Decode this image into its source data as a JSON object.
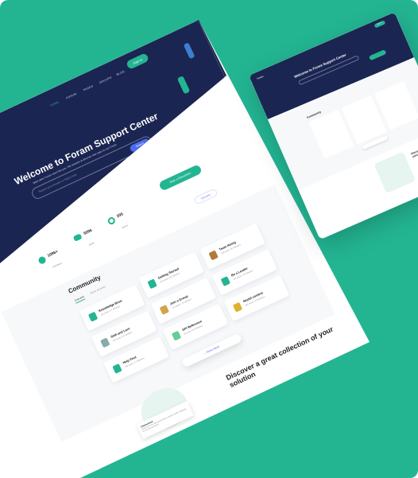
{
  "colors": {
    "background": "#23b592",
    "hero": "#1b2551",
    "accent": "#23b592",
    "link": "#4a6cf0"
  },
  "header": {
    "logo": "Foram",
    "nav": [
      "HOME",
      "FORUM",
      "PAGES",
      "GROUPS",
      "BLOG"
    ],
    "signin": "Sign in"
  },
  "hero": {
    "title": "Welcome to Foram Support Center",
    "subtitle": "Meet other Foram users like you. Get answers & discover new ways to use Foram",
    "search_placeholder": "Search your Answer or Topics here",
    "search_button": "Search",
    "cta": "Start a Discussion"
  },
  "stats": [
    {
      "value": "1096+",
      "label": "members",
      "icon": "user-icon"
    },
    {
      "value": "5096",
      "label": "posts",
      "icon": "chat-icon"
    },
    {
      "value": "205",
      "label": "topics",
      "icon": "wifi-icon"
    }
  ],
  "discover_button": "Discover",
  "community": {
    "title": "Community",
    "tabs": [
      "Overview",
      "Show all posts"
    ],
    "cards": [
      {
        "name": "Knowledge Base",
        "meta": "120 posts | 37 followers"
      },
      {
        "name": "Getting Started",
        "meta": "120 posts | 30 followers"
      },
      {
        "name": "Team Hiring",
        "meta": "130 posts | 30 followers"
      },
      {
        "name": "Skill and Lore",
        "meta": "120 posts | 30 followers"
      },
      {
        "name": "Join a Group",
        "meta": "170 posts | 75 followers"
      },
      {
        "name": "Be a Leader",
        "meta": "190 posts | 35 followers"
      },
      {
        "name": "Help Post",
        "meta": "120 posts | 17 followers"
      },
      {
        "name": "API Reference",
        "meta": "90 posts | 30 followers"
      },
      {
        "name": "Model contest",
        "meta": "300 posts | 59 followers"
      }
    ],
    "show_more": "Show More"
  },
  "discover": {
    "title": "Discover a great collection of your solution",
    "comment_author": "Cheesemint",
    "comment_text": "Came up in our discussion with a couple of team members on this and we found"
  }
}
